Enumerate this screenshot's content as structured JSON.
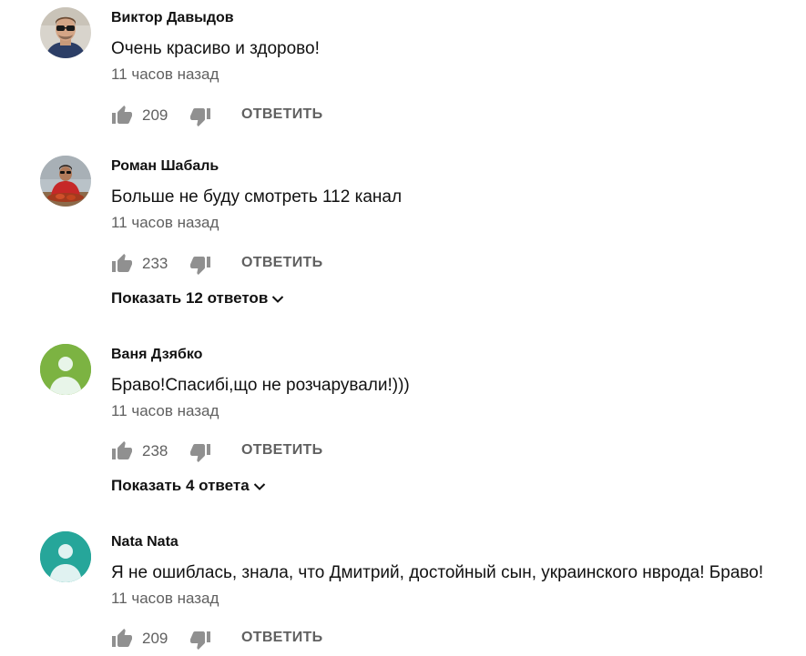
{
  "comments": [
    {
      "author": "Виктор Давыдов",
      "text": "Очень красиво и здорово!",
      "time": "11 часов назад",
      "likes": "209",
      "reply_label": "ОТВЕТИТЬ",
      "avatar": "photo-man-sunglasses"
    },
    {
      "author": "Роман Шабаль",
      "text": "Больше не буду смотреть 112 канал",
      "time": "11 часов назад",
      "likes": "233",
      "reply_label": "ОТВЕТИТЬ",
      "replies_label": "Показать 12 ответов",
      "avatar": "photo-man-red-shirt"
    },
    {
      "author": "Ваня Дзябко",
      "text": "Браво!Спасибі,що не розчарували!)))",
      "time": "11 часов назад",
      "likes": "238",
      "reply_label": "ОТВЕТИТЬ",
      "replies_label": "Показать 4 ответа",
      "avatar": "default-user-icon",
      "avatar_color": "#7cb342"
    },
    {
      "author": "Nata Nata",
      "text": "Я не ошиблась, знала, что Дмитрий, достойный сын, украинского нврода! Браво!",
      "time": "11 часов назад",
      "likes": "209",
      "reply_label": "ОТВЕТИТЬ",
      "avatar": "default-user-icon",
      "avatar_color": "#26a69a"
    }
  ],
  "colors": {
    "icon_gray": "#909090",
    "secondary_text": "#606060",
    "primary_text": "#111111"
  }
}
